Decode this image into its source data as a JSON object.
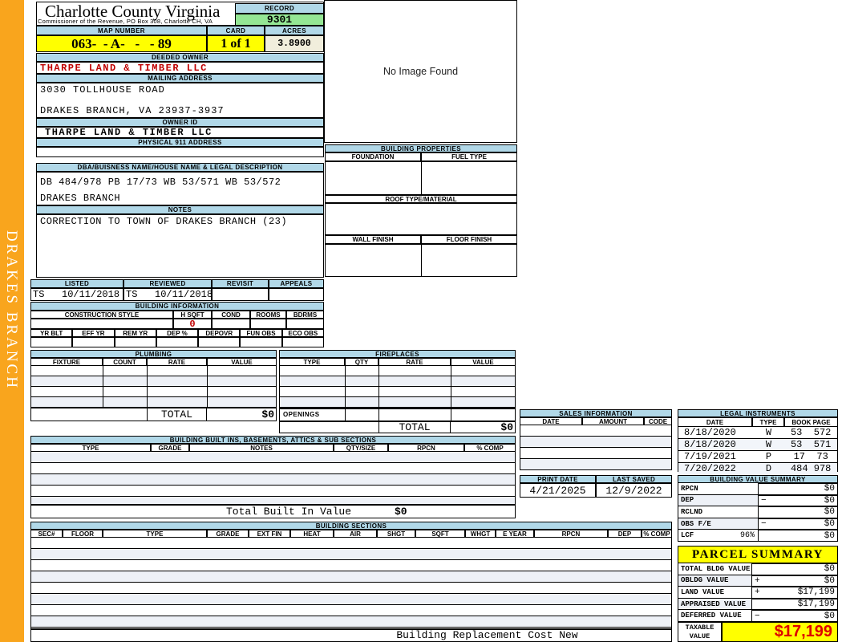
{
  "county": {
    "title": "Charlotte County Virginia",
    "subtitle": "Commissioner of the Revenue, PO Box 308, Charlotte CH, VA"
  },
  "record": {
    "label": "RECORD",
    "value": "9301"
  },
  "map": {
    "map_number_label": "MAP NUMBER",
    "map_number": "063-  - A-   -   - 89",
    "card_label": "CARD",
    "card": "1 of 1",
    "acres_label": "ACRES",
    "acres": "3.8900"
  },
  "owner": {
    "deeded_owner_label": "DEEDED OWNER",
    "deeded_owner": "THARPE LAND & TIMBER LLC",
    "mailing_address_label": "MAILING ADDRESS",
    "mailing_address_line1": "3030 TOLLHOUSE ROAD",
    "mailing_address_line2": "DRAKES BRANCH, VA 23937-3937",
    "owner_id_label": "OWNER ID",
    "owner_id": "THARPE LAND & TIMBER LLC",
    "physical_address_label": "PHYSICAL 911 ADDRESS",
    "physical_address": ""
  },
  "legal": {
    "dba_label": "DBA/BUISNESS NAME/HOUSE NAME & LEGAL DESCRIPTION",
    "description_line1": "DB 484/978 PB 17/73 WB 53/571 WB 53/572",
    "description_line2": "DRAKES BRANCH",
    "notes_label": "NOTES",
    "notes": "CORRECTION TO TOWN OF DRAKES BRANCH (23)"
  },
  "review": {
    "headers": [
      "LISTED",
      "REVIEWED",
      "REVISIT",
      "APPEALS"
    ],
    "listed": "TS   10/11/2018",
    "reviewed": "TS   10/11/2018",
    "revisit": "",
    "appeals": ""
  },
  "building_info": {
    "title": "BUILDING INFORMATION",
    "row1_headers": [
      "CONSTRUCTION STYLE",
      "H SQFT",
      "COND",
      "ROOMS",
      "BDRMS"
    ],
    "h_sqft": "0",
    "row2_headers": [
      "YR BLT",
      "EFF YR",
      "REM YR",
      "DEP %",
      "DEPOVR",
      "FUN OBS",
      "ECO OBS"
    ]
  },
  "building_properties": {
    "title": "BUILDING PROPERTIES",
    "foundation_label": "FOUNDATION",
    "fuel_type_label": "FUEL TYPE",
    "roof_label": "ROOF TYPE/MATERIAL",
    "wall_label": "WALL FINISH",
    "floor_label": "FLOOR FINISH"
  },
  "image_panel": {
    "text": "No Image Found"
  },
  "plumbing": {
    "title": "PLUMBING",
    "headers": [
      "FIXTURE",
      "COUNT",
      "RATE",
      "VALUE"
    ],
    "total_label": "TOTAL",
    "total_value": "$0"
  },
  "fireplaces": {
    "title": "FIREPLACES",
    "headers": [
      "TYPE",
      "QTY",
      "RATE",
      "VALUE"
    ],
    "openings_label": "OPENINGS",
    "total_label": "TOTAL",
    "total_value": "$0"
  },
  "built_ins": {
    "title": "BUILDING BUILT INS, BASEMENTS, ATTICS & SUB SECTIONS",
    "headers": [
      "TYPE",
      "GRADE",
      "NOTES",
      "QTY/SIZE",
      "RPCN",
      "% COMP"
    ],
    "total_label": "Total Built In Value",
    "total_value": "$0"
  },
  "sales": {
    "title": "SALES INFORMATION",
    "headers": [
      "DATE",
      "AMOUNT",
      "CODE"
    ]
  },
  "legal_instruments": {
    "title": "LEGAL INSTRUMENTS",
    "headers": [
      "DATE",
      "TYPE",
      "BOOK PAGE"
    ],
    "rows": [
      {
        "date": "8/18/2020",
        "type": "W",
        "book_page": "53  572"
      },
      {
        "date": "8/18/2020",
        "type": "W",
        "book_page": "53  571"
      },
      {
        "date": "7/19/2021",
        "type": "P",
        "book_page": "17  73"
      },
      {
        "date": "7/20/2022",
        "type": "D",
        "book_page": "484 978"
      }
    ]
  },
  "print_info": {
    "print_date_label": "PRINT DATE",
    "print_date": "4/21/2025",
    "last_saved_label": "LAST SAVED",
    "last_saved": "12/9/2022"
  },
  "building_value_summary": {
    "title": "BUILDING VALUE SUMMARY",
    "rows": [
      {
        "label": "RPCN",
        "pct": "",
        "sign": "",
        "value": "$0"
      },
      {
        "label": "DEP",
        "pct": "",
        "sign": "−",
        "value": "$0"
      },
      {
        "label": "RCLND",
        "pct": "",
        "sign": "",
        "value": "$0"
      },
      {
        "label": "OBS F/E",
        "pct": "",
        "sign": "−",
        "value": "$0"
      },
      {
        "label": "LCF",
        "pct": "96%",
        "sign": "",
        "value": "$0"
      }
    ]
  },
  "building_sections": {
    "title": "BUILDING SECTIONS",
    "headers": [
      "SEC#",
      "FLOOR",
      "TYPE",
      "GRADE",
      "EXT FIN",
      "HEAT",
      "AIR",
      "SHGT",
      "SQFT",
      "WHGT",
      "E YEAR",
      "RPCN",
      "DEP",
      "% COMP"
    ],
    "footer": "Building Replacement Cost New"
  },
  "parcel_summary": {
    "title": "PARCEL SUMMARY",
    "rows": [
      {
        "label": "TOTAL BLDG VALUE",
        "sign": "",
        "value": "$0"
      },
      {
        "label": "OBLDG VALUE",
        "sign": "+",
        "value": "$0"
      },
      {
        "label": "LAND VALUE",
        "sign": "+",
        "value": "$17,199"
      },
      {
        "label": "APPRAISED VALUE",
        "sign": "",
        "value": "$17,199"
      },
      {
        "label": "DEFERRED VALUE",
        "sign": "−",
        "value": "$0"
      }
    ],
    "taxable_label": "TAXABLE VALUE",
    "taxable_value": "$17,199"
  },
  "sidebar": {
    "district": "DRAKES BRANCH"
  },
  "colors": {
    "accent_orange": "#F9A51D",
    "header_blue": "#B1D8E8",
    "record_green": "#94E694",
    "highlight_yellow": "#FFFF00",
    "acres_cream": "#F1EEDC",
    "alt_row": "#EEF1F7",
    "value_red": "#C00000",
    "taxable_red": "#DE0000"
  }
}
